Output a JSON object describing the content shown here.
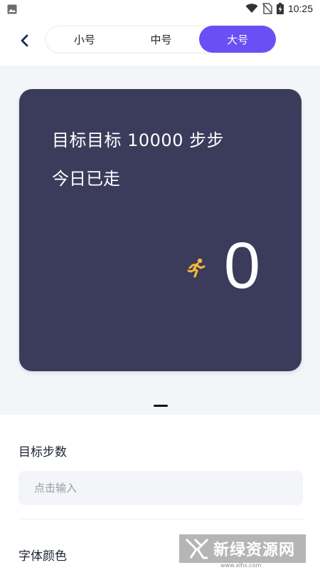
{
  "status_bar": {
    "time": "10:25",
    "icons": [
      "image-icon",
      "wifi-icon",
      "no-sim-icon",
      "battery-charging-icon"
    ]
  },
  "header": {
    "back_icon": "chevron-left-icon",
    "segments": [
      {
        "label": "小号",
        "active": false
      },
      {
        "label": "中号",
        "active": false
      },
      {
        "label": "大号",
        "active": true
      }
    ],
    "accent_color": "#6a4ff5"
  },
  "preview": {
    "card_color": "#3b3b5c",
    "goal_text": "目标目标 10000 步步",
    "today_label": "今日已走",
    "runner_icon": "running-person-icon",
    "steps": "0"
  },
  "form": {
    "goal_label": "目标步数",
    "goal_placeholder": "点击输入",
    "goal_value": "",
    "color_label": "字体颜色"
  },
  "watermark": {
    "text": "新绿资源网",
    "sub": "www.xlhs.com"
  }
}
